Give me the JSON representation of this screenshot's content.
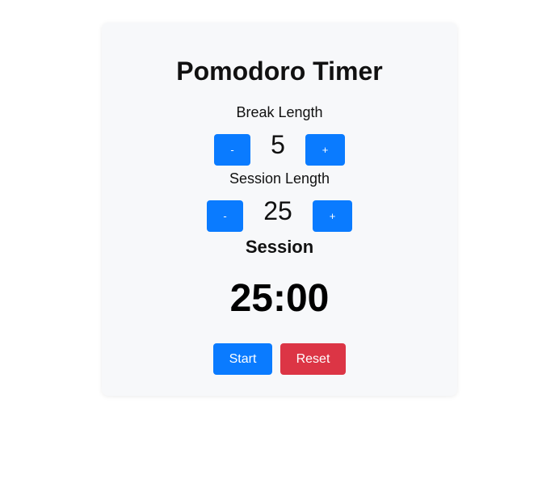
{
  "app": {
    "title": "Pomodoro Timer"
  },
  "break_length": {
    "label": "Break Length",
    "value": "5",
    "decrement_label": "-",
    "increment_label": "+"
  },
  "session_length": {
    "label": "Session Length",
    "value": "25",
    "decrement_label": "-",
    "increment_label": "+"
  },
  "timer": {
    "mode_label": "Session",
    "time_left": "25:00"
  },
  "controls": {
    "start_label": "Start",
    "reset_label": "Reset"
  },
  "colors": {
    "primary_button": "#0a7bff",
    "danger_button": "#dc3545",
    "card_background": "#f7f8fa"
  }
}
